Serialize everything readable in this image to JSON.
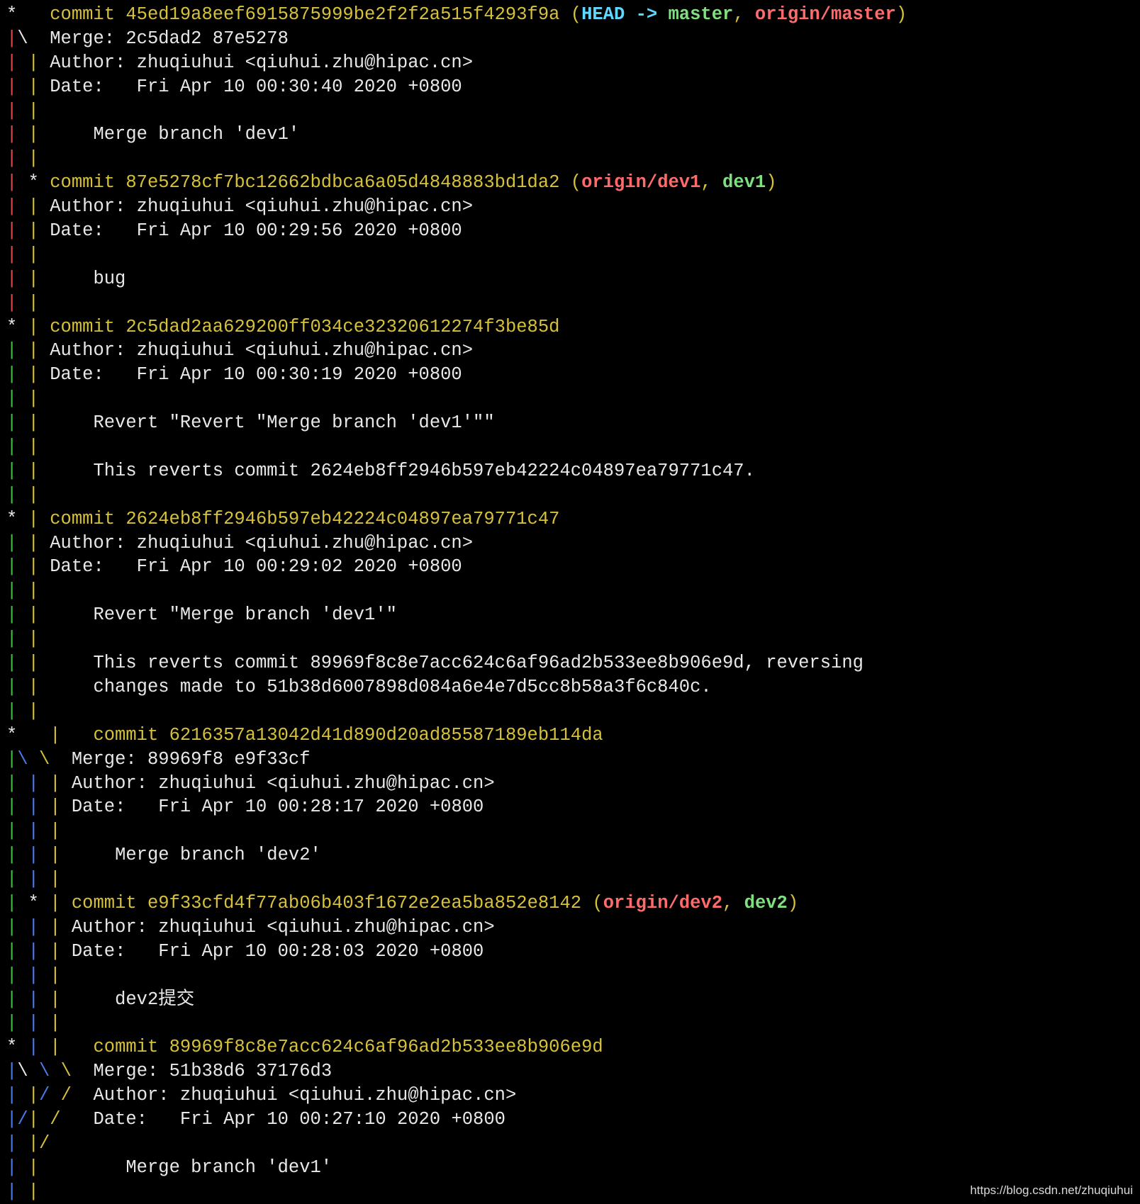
{
  "colors": {
    "text": "#e8e8e8",
    "commit_yellow": "#d7c13a",
    "head_cyan": "#5fd7ff",
    "branch_green": "#7ee07e",
    "remote_red": "#ff6b6b",
    "graph_red": "#e04848",
    "graph_yellow": "#d7c13a",
    "graph_blue": "#4a7bf0",
    "graph_green": "#3fbf3f",
    "background": "#000000"
  },
  "watermark": "https://blog.csdn.net/zhuqiuhui",
  "lines": [
    [
      {
        "t": "*   ",
        "c": "text"
      },
      {
        "t": "commit 45ed19a8eef6915875999be2f2f2a515f4293f9a ",
        "c": "commit_yellow"
      },
      {
        "t": "(",
        "c": "commit_yellow"
      },
      {
        "t": "HEAD -> ",
        "c": "head_cyan",
        "b": true
      },
      {
        "t": "master",
        "c": "branch_green",
        "b": true
      },
      {
        "t": ", ",
        "c": "commit_yellow"
      },
      {
        "t": "origin/master",
        "c": "remote_red",
        "b": true
      },
      {
        "t": ")",
        "c": "commit_yellow"
      }
    ],
    [
      {
        "t": "|",
        "c": "graph_red"
      },
      {
        "t": "\\",
        "c": "text"
      },
      {
        "t": "  Merge: 2c5dad2 87e5278",
        "c": "text"
      }
    ],
    [
      {
        "t": "|",
        "c": "graph_red"
      },
      {
        "t": " ",
        "c": "text"
      },
      {
        "t": "|",
        "c": "graph_yellow"
      },
      {
        "t": " Author: zhuqiuhui <qiuhui.zhu@hipac.cn>",
        "c": "text"
      }
    ],
    [
      {
        "t": "|",
        "c": "graph_red"
      },
      {
        "t": " ",
        "c": "text"
      },
      {
        "t": "|",
        "c": "graph_yellow"
      },
      {
        "t": " Date:   Fri Apr 10 00:30:40 2020 +0800",
        "c": "text"
      }
    ],
    [
      {
        "t": "|",
        "c": "graph_red"
      },
      {
        "t": " ",
        "c": "text"
      },
      {
        "t": "|",
        "c": "graph_yellow"
      }
    ],
    [
      {
        "t": "|",
        "c": "graph_red"
      },
      {
        "t": " ",
        "c": "text"
      },
      {
        "t": "|",
        "c": "graph_yellow"
      },
      {
        "t": "     Merge branch 'dev1'",
        "c": "text"
      }
    ],
    [
      {
        "t": "|",
        "c": "graph_red"
      },
      {
        "t": " ",
        "c": "text"
      },
      {
        "t": "|",
        "c": "graph_yellow"
      }
    ],
    [
      {
        "t": "|",
        "c": "graph_red"
      },
      {
        "t": " * ",
        "c": "text"
      },
      {
        "t": "commit 87e5278cf7bc12662bdbca6a05d4848883bd1da2 ",
        "c": "commit_yellow"
      },
      {
        "t": "(",
        "c": "commit_yellow"
      },
      {
        "t": "origin/dev1",
        "c": "remote_red",
        "b": true
      },
      {
        "t": ", ",
        "c": "commit_yellow"
      },
      {
        "t": "dev1",
        "c": "branch_green",
        "b": true
      },
      {
        "t": ")",
        "c": "commit_yellow"
      }
    ],
    [
      {
        "t": "|",
        "c": "graph_red"
      },
      {
        "t": " ",
        "c": "text"
      },
      {
        "t": "|",
        "c": "graph_yellow"
      },
      {
        "t": " Author: zhuqiuhui <qiuhui.zhu@hipac.cn>",
        "c": "text"
      }
    ],
    [
      {
        "t": "|",
        "c": "graph_red"
      },
      {
        "t": " ",
        "c": "text"
      },
      {
        "t": "|",
        "c": "graph_yellow"
      },
      {
        "t": " Date:   Fri Apr 10 00:29:56 2020 +0800",
        "c": "text"
      }
    ],
    [
      {
        "t": "|",
        "c": "graph_red"
      },
      {
        "t": " ",
        "c": "text"
      },
      {
        "t": "|",
        "c": "graph_yellow"
      }
    ],
    [
      {
        "t": "|",
        "c": "graph_red"
      },
      {
        "t": " ",
        "c": "text"
      },
      {
        "t": "|",
        "c": "graph_yellow"
      },
      {
        "t": "     bug",
        "c": "text"
      }
    ],
    [
      {
        "t": "|",
        "c": "graph_red"
      },
      {
        "t": " ",
        "c": "text"
      },
      {
        "t": "|",
        "c": "graph_yellow"
      }
    ],
    [
      {
        "t": "* ",
        "c": "text"
      },
      {
        "t": "|",
        "c": "graph_yellow"
      },
      {
        "t": " ",
        "c": "text"
      },
      {
        "t": "commit 2c5dad2aa629200ff034ce32320612274f3be85d",
        "c": "commit_yellow"
      }
    ],
    [
      {
        "t": "|",
        "c": "graph_green"
      },
      {
        "t": " ",
        "c": "text"
      },
      {
        "t": "|",
        "c": "graph_yellow"
      },
      {
        "t": " Author: zhuqiuhui <qiuhui.zhu@hipac.cn>",
        "c": "text"
      }
    ],
    [
      {
        "t": "|",
        "c": "graph_green"
      },
      {
        "t": " ",
        "c": "text"
      },
      {
        "t": "|",
        "c": "graph_yellow"
      },
      {
        "t": " Date:   Fri Apr 10 00:30:19 2020 +0800",
        "c": "text"
      }
    ],
    [
      {
        "t": "|",
        "c": "graph_green"
      },
      {
        "t": " ",
        "c": "text"
      },
      {
        "t": "|",
        "c": "graph_yellow"
      }
    ],
    [
      {
        "t": "|",
        "c": "graph_green"
      },
      {
        "t": " ",
        "c": "text"
      },
      {
        "t": "|",
        "c": "graph_yellow"
      },
      {
        "t": "     Revert \"Revert \"Merge branch 'dev1'\"\"",
        "c": "text"
      }
    ],
    [
      {
        "t": "|",
        "c": "graph_green"
      },
      {
        "t": " ",
        "c": "text"
      },
      {
        "t": "|",
        "c": "graph_yellow"
      }
    ],
    [
      {
        "t": "|",
        "c": "graph_green"
      },
      {
        "t": " ",
        "c": "text"
      },
      {
        "t": "|",
        "c": "graph_yellow"
      },
      {
        "t": "     This reverts commit 2624eb8ff2946b597eb42224c04897ea79771c47.",
        "c": "text"
      }
    ],
    [
      {
        "t": "|",
        "c": "graph_green"
      },
      {
        "t": " ",
        "c": "text"
      },
      {
        "t": "|",
        "c": "graph_yellow"
      }
    ],
    [
      {
        "t": "* ",
        "c": "text"
      },
      {
        "t": "|",
        "c": "graph_yellow"
      },
      {
        "t": " ",
        "c": "text"
      },
      {
        "t": "commit 2624eb8ff2946b597eb42224c04897ea79771c47",
        "c": "commit_yellow"
      }
    ],
    [
      {
        "t": "|",
        "c": "graph_green"
      },
      {
        "t": " ",
        "c": "text"
      },
      {
        "t": "|",
        "c": "graph_yellow"
      },
      {
        "t": " Author: zhuqiuhui <qiuhui.zhu@hipac.cn>",
        "c": "text"
      }
    ],
    [
      {
        "t": "|",
        "c": "graph_green"
      },
      {
        "t": " ",
        "c": "text"
      },
      {
        "t": "|",
        "c": "graph_yellow"
      },
      {
        "t": " Date:   Fri Apr 10 00:29:02 2020 +0800",
        "c": "text"
      }
    ],
    [
      {
        "t": "|",
        "c": "graph_green"
      },
      {
        "t": " ",
        "c": "text"
      },
      {
        "t": "|",
        "c": "graph_yellow"
      }
    ],
    [
      {
        "t": "|",
        "c": "graph_green"
      },
      {
        "t": " ",
        "c": "text"
      },
      {
        "t": "|",
        "c": "graph_yellow"
      },
      {
        "t": "     Revert \"Merge branch 'dev1'\"",
        "c": "text"
      }
    ],
    [
      {
        "t": "|",
        "c": "graph_green"
      },
      {
        "t": " ",
        "c": "text"
      },
      {
        "t": "|",
        "c": "graph_yellow"
      }
    ],
    [
      {
        "t": "|",
        "c": "graph_green"
      },
      {
        "t": " ",
        "c": "text"
      },
      {
        "t": "|",
        "c": "graph_yellow"
      },
      {
        "t": "     This reverts commit 89969f8c8e7acc624c6af96ad2b533ee8b906e9d, reversing",
        "c": "text"
      }
    ],
    [
      {
        "t": "|",
        "c": "graph_green"
      },
      {
        "t": " ",
        "c": "text"
      },
      {
        "t": "|",
        "c": "graph_yellow"
      },
      {
        "t": "     changes made to 51b38d6007898d084a6e4e7d5cc8b58a3f6c840c.",
        "c": "text"
      }
    ],
    [
      {
        "t": "|",
        "c": "graph_green"
      },
      {
        "t": " ",
        "c": "text"
      },
      {
        "t": "|",
        "c": "graph_yellow"
      }
    ],
    [
      {
        "t": "*   ",
        "c": "text"
      },
      {
        "t": "|",
        "c": "graph_yellow"
      },
      {
        "t": "   ",
        "c": "text"
      },
      {
        "t": "commit 6216357a13042d41d890d20ad85587189eb114da",
        "c": "commit_yellow"
      }
    ],
    [
      {
        "t": "|",
        "c": "graph_green"
      },
      {
        "t": "\\",
        "c": "graph_blue"
      },
      {
        "t": " ",
        "c": "text"
      },
      {
        "t": "\\",
        "c": "graph_yellow"
      },
      {
        "t": "  Merge: 89969f8 e9f33cf",
        "c": "text"
      }
    ],
    [
      {
        "t": "|",
        "c": "graph_green"
      },
      {
        "t": " ",
        "c": "text"
      },
      {
        "t": "|",
        "c": "graph_blue"
      },
      {
        "t": " ",
        "c": "text"
      },
      {
        "t": "|",
        "c": "graph_yellow"
      },
      {
        "t": " Author: zhuqiuhui <qiuhui.zhu@hipac.cn>",
        "c": "text"
      }
    ],
    [
      {
        "t": "|",
        "c": "graph_green"
      },
      {
        "t": " ",
        "c": "text"
      },
      {
        "t": "|",
        "c": "graph_blue"
      },
      {
        "t": " ",
        "c": "text"
      },
      {
        "t": "|",
        "c": "graph_yellow"
      },
      {
        "t": " Date:   Fri Apr 10 00:28:17 2020 +0800",
        "c": "text"
      }
    ],
    [
      {
        "t": "|",
        "c": "graph_green"
      },
      {
        "t": " ",
        "c": "text"
      },
      {
        "t": "|",
        "c": "graph_blue"
      },
      {
        "t": " ",
        "c": "text"
      },
      {
        "t": "|",
        "c": "graph_yellow"
      }
    ],
    [
      {
        "t": "|",
        "c": "graph_green"
      },
      {
        "t": " ",
        "c": "text"
      },
      {
        "t": "|",
        "c": "graph_blue"
      },
      {
        "t": " ",
        "c": "text"
      },
      {
        "t": "|",
        "c": "graph_yellow"
      },
      {
        "t": "     Merge branch 'dev2'",
        "c": "text"
      }
    ],
    [
      {
        "t": "|",
        "c": "graph_green"
      },
      {
        "t": " ",
        "c": "text"
      },
      {
        "t": "|",
        "c": "graph_blue"
      },
      {
        "t": " ",
        "c": "text"
      },
      {
        "t": "|",
        "c": "graph_yellow"
      }
    ],
    [
      {
        "t": "|",
        "c": "graph_green"
      },
      {
        "t": " * ",
        "c": "text"
      },
      {
        "t": "|",
        "c": "graph_yellow"
      },
      {
        "t": " ",
        "c": "text"
      },
      {
        "t": "commit e9f33cfd4f77ab06b403f1672e2ea5ba852e8142 ",
        "c": "commit_yellow"
      },
      {
        "t": "(",
        "c": "commit_yellow"
      },
      {
        "t": "origin/dev2",
        "c": "remote_red",
        "b": true
      },
      {
        "t": ", ",
        "c": "commit_yellow"
      },
      {
        "t": "dev2",
        "c": "branch_green",
        "b": true
      },
      {
        "t": ")",
        "c": "commit_yellow"
      }
    ],
    [
      {
        "t": "|",
        "c": "graph_green"
      },
      {
        "t": " ",
        "c": "text"
      },
      {
        "t": "|",
        "c": "graph_blue"
      },
      {
        "t": " ",
        "c": "text"
      },
      {
        "t": "|",
        "c": "graph_yellow"
      },
      {
        "t": " Author: zhuqiuhui <qiuhui.zhu@hipac.cn>",
        "c": "text"
      }
    ],
    [
      {
        "t": "|",
        "c": "graph_green"
      },
      {
        "t": " ",
        "c": "text"
      },
      {
        "t": "|",
        "c": "graph_blue"
      },
      {
        "t": " ",
        "c": "text"
      },
      {
        "t": "|",
        "c": "graph_yellow"
      },
      {
        "t": " Date:   Fri Apr 10 00:28:03 2020 +0800",
        "c": "text"
      }
    ],
    [
      {
        "t": "|",
        "c": "graph_green"
      },
      {
        "t": " ",
        "c": "text"
      },
      {
        "t": "|",
        "c": "graph_blue"
      },
      {
        "t": " ",
        "c": "text"
      },
      {
        "t": "|",
        "c": "graph_yellow"
      }
    ],
    [
      {
        "t": "|",
        "c": "graph_green"
      },
      {
        "t": " ",
        "c": "text"
      },
      {
        "t": "|",
        "c": "graph_blue"
      },
      {
        "t": " ",
        "c": "text"
      },
      {
        "t": "|",
        "c": "graph_yellow"
      },
      {
        "t": "     dev2提交",
        "c": "text"
      }
    ],
    [
      {
        "t": "|",
        "c": "graph_green"
      },
      {
        "t": " ",
        "c": "text"
      },
      {
        "t": "|",
        "c": "graph_blue"
      },
      {
        "t": " ",
        "c": "text"
      },
      {
        "t": "|",
        "c": "graph_yellow"
      }
    ],
    [
      {
        "t": "* ",
        "c": "text"
      },
      {
        "t": "|",
        "c": "graph_blue"
      },
      {
        "t": " ",
        "c": "text"
      },
      {
        "t": "|",
        "c": "graph_yellow"
      },
      {
        "t": "   ",
        "c": "text"
      },
      {
        "t": "commit 89969f8c8e7acc624c6af96ad2b533ee8b906e9d",
        "c": "commit_yellow"
      }
    ],
    [
      {
        "t": "|",
        "c": "graph_blue"
      },
      {
        "t": "\\",
        "c": "text"
      },
      {
        "t": " ",
        "c": "text"
      },
      {
        "t": "\\",
        "c": "graph_blue"
      },
      {
        "t": " ",
        "c": "text"
      },
      {
        "t": "\\",
        "c": "graph_yellow"
      },
      {
        "t": "  Merge: 51b38d6 37176d3",
        "c": "text"
      }
    ],
    [
      {
        "t": "|",
        "c": "graph_blue"
      },
      {
        "t": " ",
        "c": "text"
      },
      {
        "t": "|",
        "c": "graph_yellow"
      },
      {
        "t": "/",
        "c": "graph_blue"
      },
      {
        "t": " ",
        "c": "text"
      },
      {
        "t": "/",
        "c": "graph_yellow"
      },
      {
        "t": "  Author: zhuqiuhui <qiuhui.zhu@hipac.cn>",
        "c": "text"
      }
    ],
    [
      {
        "t": "|",
        "c": "graph_blue"
      },
      {
        "t": "/",
        "c": "graph_blue"
      },
      {
        "t": "|",
        "c": "graph_yellow"
      },
      {
        "t": " ",
        "c": "text"
      },
      {
        "t": "/",
        "c": "graph_yellow"
      },
      {
        "t": "   Date:   Fri Apr 10 00:27:10 2020 +0800",
        "c": "text"
      }
    ],
    [
      {
        "t": "|",
        "c": "graph_blue"
      },
      {
        "t": " ",
        "c": "text"
      },
      {
        "t": "|",
        "c": "graph_yellow"
      },
      {
        "t": "/",
        "c": "graph_yellow"
      }
    ],
    [
      {
        "t": "|",
        "c": "graph_blue"
      },
      {
        "t": " ",
        "c": "text"
      },
      {
        "t": "|",
        "c": "graph_yellow"
      },
      {
        "t": "        Merge branch 'dev1'",
        "c": "text"
      }
    ],
    [
      {
        "t": "|",
        "c": "graph_blue"
      },
      {
        "t": " ",
        "c": "text"
      },
      {
        "t": "|",
        "c": "graph_yellow"
      }
    ]
  ]
}
